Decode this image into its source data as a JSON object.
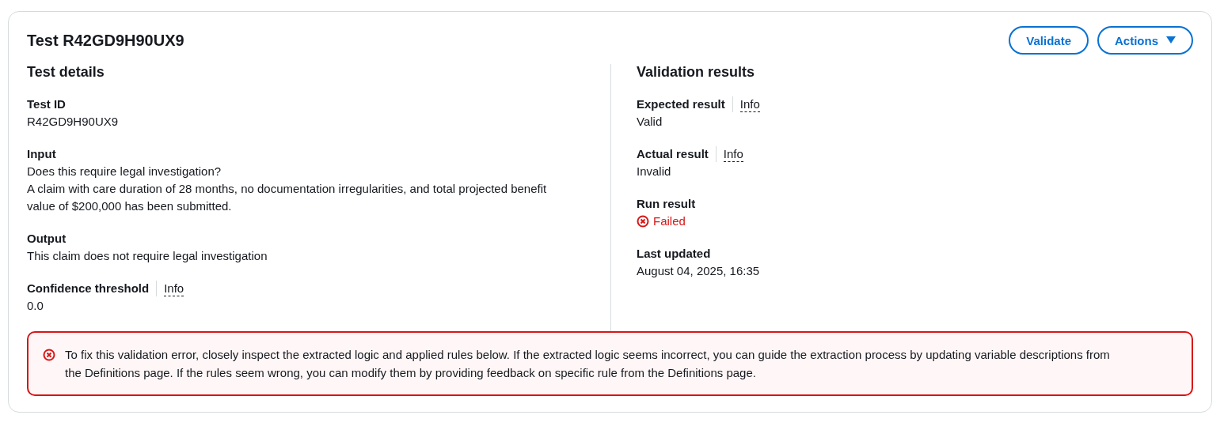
{
  "card": {
    "title": "Test R42GD9H90UX9",
    "buttons": [
      {
        "label": "Validate",
        "kind": "button"
      },
      {
        "label": "Actions",
        "kind": "dropdown"
      }
    ]
  },
  "columns": [
    {
      "heading": "Test details",
      "fields": [
        {
          "label": "Test ID",
          "lines": [
            "R42GD9H90UX9"
          ]
        },
        {
          "label": "Input",
          "lines": [
            "Does this require legal investigation?",
            "A claim with care duration of 28 months, no documentation irregularities, and total projected benefit value of $200,000 has been submitted."
          ]
        },
        {
          "label": "Output",
          "lines": [
            "This claim does not require legal investigation"
          ]
        },
        {
          "label": "Confidence threshold",
          "info": "Info",
          "lines": [
            "0.0"
          ]
        }
      ]
    },
    {
      "heading": "Validation results",
      "fields": [
        {
          "label": "Expected result",
          "info": "Info",
          "lines": [
            "Valid"
          ]
        },
        {
          "label": "Actual result",
          "info": "Info",
          "lines": [
            "Invalid"
          ]
        },
        {
          "label": "Run result",
          "kind": "failed-status",
          "lines": [
            "Failed"
          ]
        },
        {
          "label": "Last updated",
          "lines": [
            "August 04, 2025, 16:35"
          ]
        }
      ]
    }
  ],
  "alert": {
    "message": "To fix this validation error, closely inspect the extracted logic and applied rules below. If the extracted logic seems incorrect, you can guide the extraction process by updating variable descriptions from the Definitions page. If the rules seem wrong, you can modify them by providing feedback on specific rule from the Definitions page."
  }
}
